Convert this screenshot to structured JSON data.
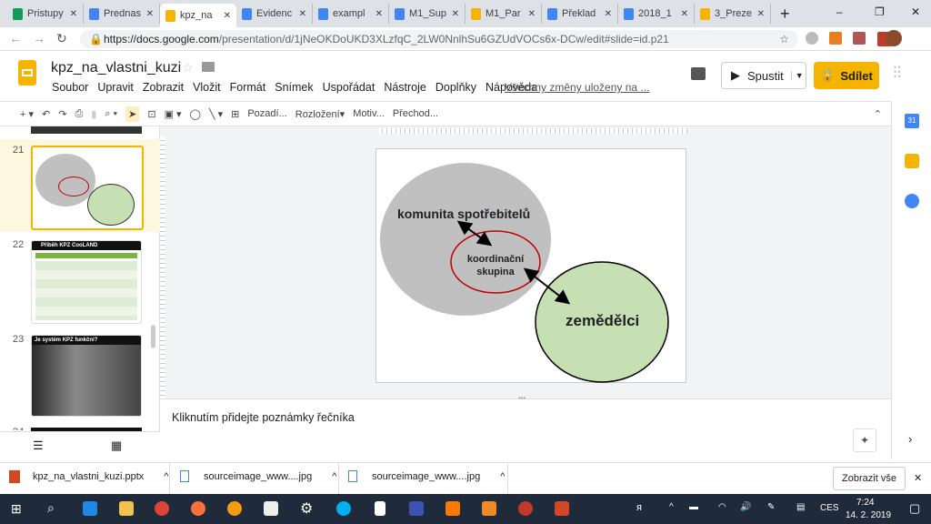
{
  "browser": {
    "tabs": [
      {
        "title": "Pristupy",
        "color": "#0f9d58"
      },
      {
        "title": "Prednas",
        "color": "#4285f4"
      },
      {
        "title": "kpz_na",
        "color": "#f4b400",
        "active": true
      },
      {
        "title": "Evidenc",
        "color": "#4285f4"
      },
      {
        "title": "exampl",
        "color": "#4285f4"
      },
      {
        "title": "M1_Sup",
        "color": "#4285f4"
      },
      {
        "title": "M1_Par",
        "color": "#f4b400"
      },
      {
        "title": "Překlad",
        "color": "#4285f4"
      },
      {
        "title": "2018_1",
        "color": "#4285f4"
      },
      {
        "title": "3_Preze",
        "color": "#f4b400"
      }
    ],
    "url_host": "https://docs.google.com",
    "url_path": "/presentation/d/1jNeOKDoUKD3XLzfqC_2LW0NnlhSu6GZUdVOCs6x-DCw/edit#slide=id.p21",
    "new_tab": "+",
    "minimize": "–",
    "restore": "❐",
    "close": "✕"
  },
  "app": {
    "title": "kpz_na_vlastni_kuzi",
    "menu": [
      "Soubor",
      "Upravit",
      "Zobrazit",
      "Vložit",
      "Formát",
      "Snímek",
      "Uspořádat",
      "Nástroje",
      "Doplňky",
      "Nápověda"
    ],
    "save_status": "Všechny změny uloženy na ...",
    "present": "Spustit",
    "share": "Sdílet"
  },
  "toolbar": {
    "background": "Pozadí...",
    "layout": "Rozložení",
    "theme": "Motiv...",
    "transition": "Přechod..."
  },
  "filmstrip": {
    "slides": [
      {
        "num": "21",
        "selected": true
      },
      {
        "num": "22",
        "title": "Příběh KPZ CooLAND"
      },
      {
        "num": "23",
        "title": "Je systém KPZ funkční?"
      },
      {
        "num": "24"
      }
    ]
  },
  "slide": {
    "consumers": "komunita spotřebitelů",
    "coord1": "koordinační",
    "coord2": "skupina",
    "farmers": "zemědělci",
    "colors": {
      "consumers": "#c0c0c0",
      "farmers": "#c6e0b4",
      "coord_border": "#c00000"
    }
  },
  "notes": {
    "placeholder": "Kliknutím přidejte poznámky řečníka"
  },
  "downloads": {
    "items": [
      "kpz_na_vlastni_kuzi.pptx",
      "sourceimage_www....jpg",
      "sourceimage_www....jpg"
    ],
    "show_all": "Zobrazit vše"
  },
  "taskbar": {
    "lang": "CES",
    "time": "7:24",
    "date": "14. 2. 2019"
  }
}
